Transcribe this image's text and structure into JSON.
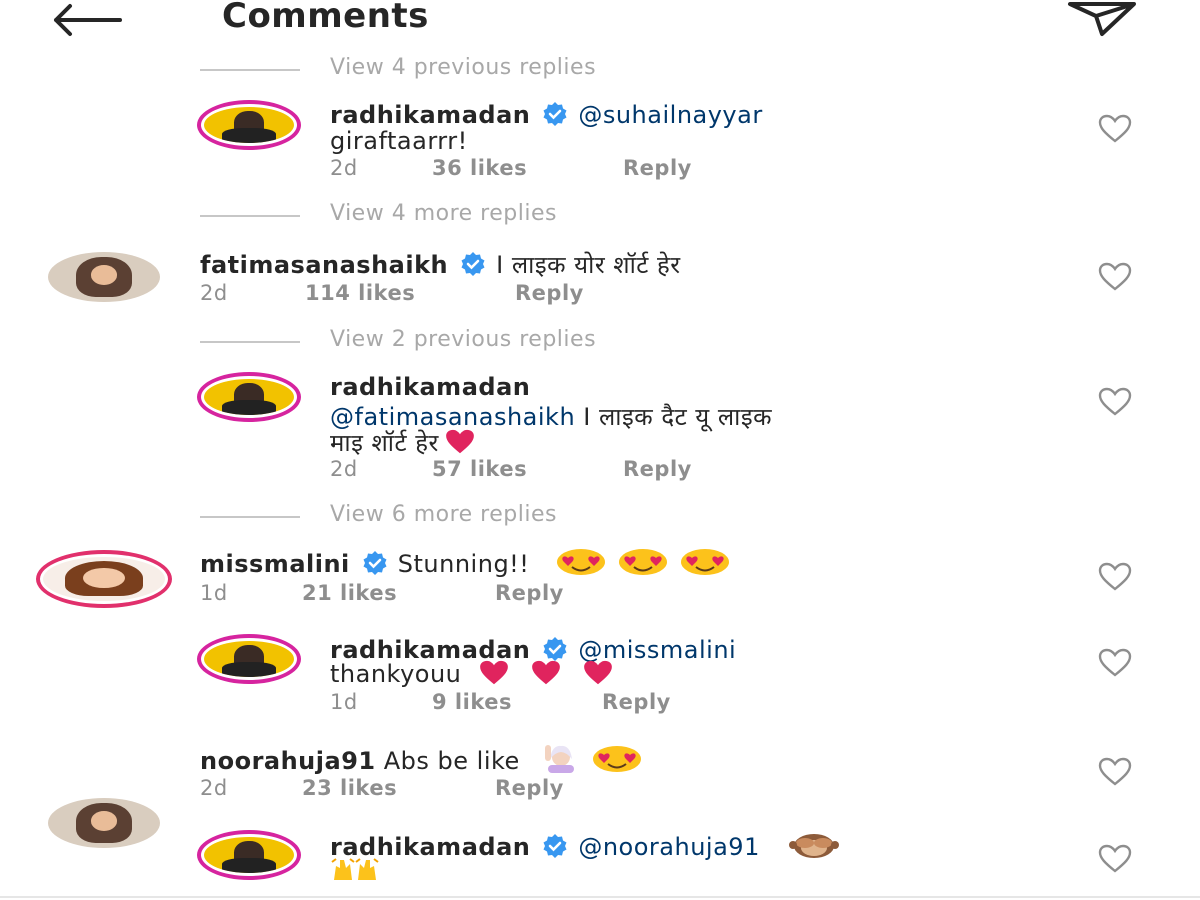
{
  "header": {
    "title": "Comments"
  },
  "threads": {
    "v1": "View 4 previous replies",
    "v2": "View 4 more replies",
    "v3": "View 2 previous replies",
    "v4": "View 6 more replies"
  },
  "comments": [
    {
      "username": "radhikamadan",
      "verified": true,
      "mention": "@suhailnayyar",
      "text": "giraftaarrr!",
      "time": "2d",
      "likes": "36 likes",
      "reply": "Reply"
    },
    {
      "username": "fatimasanashaikh",
      "verified": true,
      "text": "I लाइक योर शॉर्ट हेर",
      "time": "2d",
      "likes": "114 likes",
      "reply": "Reply"
    },
    {
      "username": "radhikamadan",
      "verified": false,
      "mention": "@fatimasanashaikh",
      "text_line1": "I लाइक दैट यू लाइक",
      "text_line2": "माइ शॉर्ट हेर",
      "emoji": "heart",
      "time": "2d",
      "likes": "57 likes",
      "reply": "Reply"
    },
    {
      "username": "missmalini",
      "verified": true,
      "text": "Stunning!!",
      "emoji": "heart-eyes x3",
      "time": "1d",
      "likes": "21 likes",
      "reply": "Reply"
    },
    {
      "username": "radhikamadan",
      "verified": true,
      "mention": "@missmalini",
      "text": "thankyouu",
      "emoji": "heart x3",
      "time": "1d",
      "likes": "9 likes",
      "reply": "Reply"
    },
    {
      "username": "noorahuja91",
      "verified": false,
      "text": "Abs be like",
      "emoji": "woman-raising-hand, heart-eyes",
      "time": "2d",
      "likes": "23 likes",
      "reply": "Reply"
    },
    {
      "username": "radhikamadan",
      "verified": true,
      "mention": "@noorahuja91",
      "emoji": "see-no-evil-monkey, raising-hands"
    }
  ],
  "colors": {
    "mention": "#00376b",
    "verified": "#3897f0",
    "heart": "#e0245e",
    "meta": "#8e8e8e",
    "story_ring": "#d6249f"
  }
}
